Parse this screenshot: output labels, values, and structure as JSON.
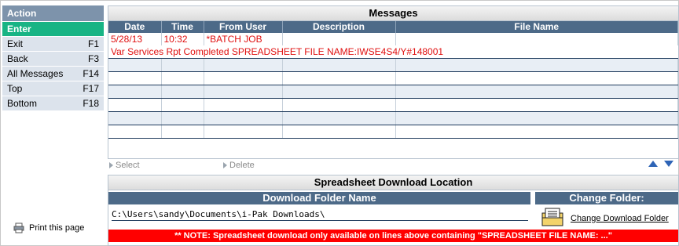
{
  "sidebar": {
    "header": "Action",
    "items": [
      {
        "label": "Enter",
        "key": ""
      },
      {
        "label": "Exit",
        "key": "F1"
      },
      {
        "label": "Back",
        "key": "F3"
      },
      {
        "label": "All Messages",
        "key": "F14"
      },
      {
        "label": "Top",
        "key": "F17"
      },
      {
        "label": "Bottom",
        "key": "F18"
      }
    ],
    "print_label": "Print this page"
  },
  "messages": {
    "title": "Messages",
    "columns": [
      "Date",
      "Time",
      "From User",
      "Description",
      "File Name"
    ],
    "row1": {
      "date": "5/28/13",
      "time": "10:32",
      "from_user": "*BATCH JOB",
      "description": "",
      "file_name": ""
    },
    "row1_detail": "Var Services Rpt Completed SPREADSHEET FILE NAME:IWSE4S4/Y#148001",
    "select_label": "Select",
    "delete_label": "Delete"
  },
  "spreadsheet": {
    "title": "Spreadsheet Download Location",
    "folder_header": "Download Folder Name",
    "change_header": "Change Folder:",
    "path": "C:\\Users\\sandy\\Documents\\i-Pak Downloads\\",
    "change_link": "Change Download Folder",
    "note": "** NOTE:  Spreadsheet download only available on lines above containing \"SPREADSHEET FILE NAME: ...\""
  },
  "colors": {
    "accent_green": "#18b484",
    "header_blue": "#4d6a88",
    "error_red": "#e01010",
    "note_red": "#ff0000"
  }
}
